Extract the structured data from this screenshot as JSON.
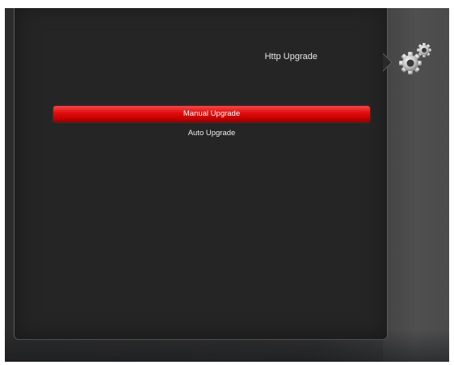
{
  "header": {
    "title": "Http Upgrade",
    "icon": "gears-icon"
  },
  "menu": {
    "items": [
      {
        "label": "Manual Upgrade",
        "selected": true
      },
      {
        "label": "Auto Upgrade",
        "selected": false
      }
    ]
  },
  "colors": {
    "highlight": "#e00f0f",
    "background": "#252525",
    "text": "#e6e6e6"
  }
}
